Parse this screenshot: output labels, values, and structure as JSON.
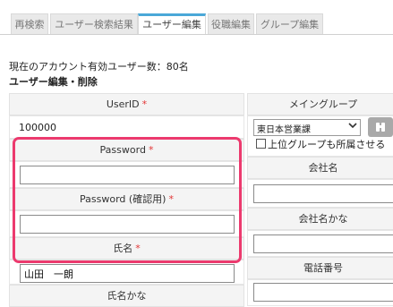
{
  "tabs": [
    {
      "label": "再検索"
    },
    {
      "label": "ユーザー検索結果"
    },
    {
      "label": "ユーザー編集"
    },
    {
      "label": "役職編集"
    },
    {
      "label": "グループ編集"
    }
  ],
  "info_text": "現在のアカウント有効ユーザー数：80名",
  "section_title": "ユーザー編集・削除",
  "form": {
    "userid_label": "UserID",
    "userid_value": "100000",
    "password_label": "Password",
    "password_value": "",
    "password_confirm_label": "Password (確認用)",
    "password_confirm_value": "",
    "name_label": "氏名",
    "name_value": "山田　一朗",
    "name_kana_label": "氏名かな",
    "required_mark": "*"
  },
  "right": {
    "main_group_label": "メイングループ",
    "main_group_value": "東日本営業課",
    "include_parent_label": "上位グループも所属させる",
    "company_label": "会社名",
    "company_value": "",
    "company_kana_label": "会社名かな",
    "company_kana_value": "",
    "phone_label": "電話番号",
    "phone_value": ""
  },
  "icons": {
    "dropdown": "chevron-down-icon",
    "search": "search-icon"
  },
  "colors": {
    "highlight": "#ec3a6e",
    "required": "#e23636",
    "active_tab_accent": "#4aa8d8"
  }
}
